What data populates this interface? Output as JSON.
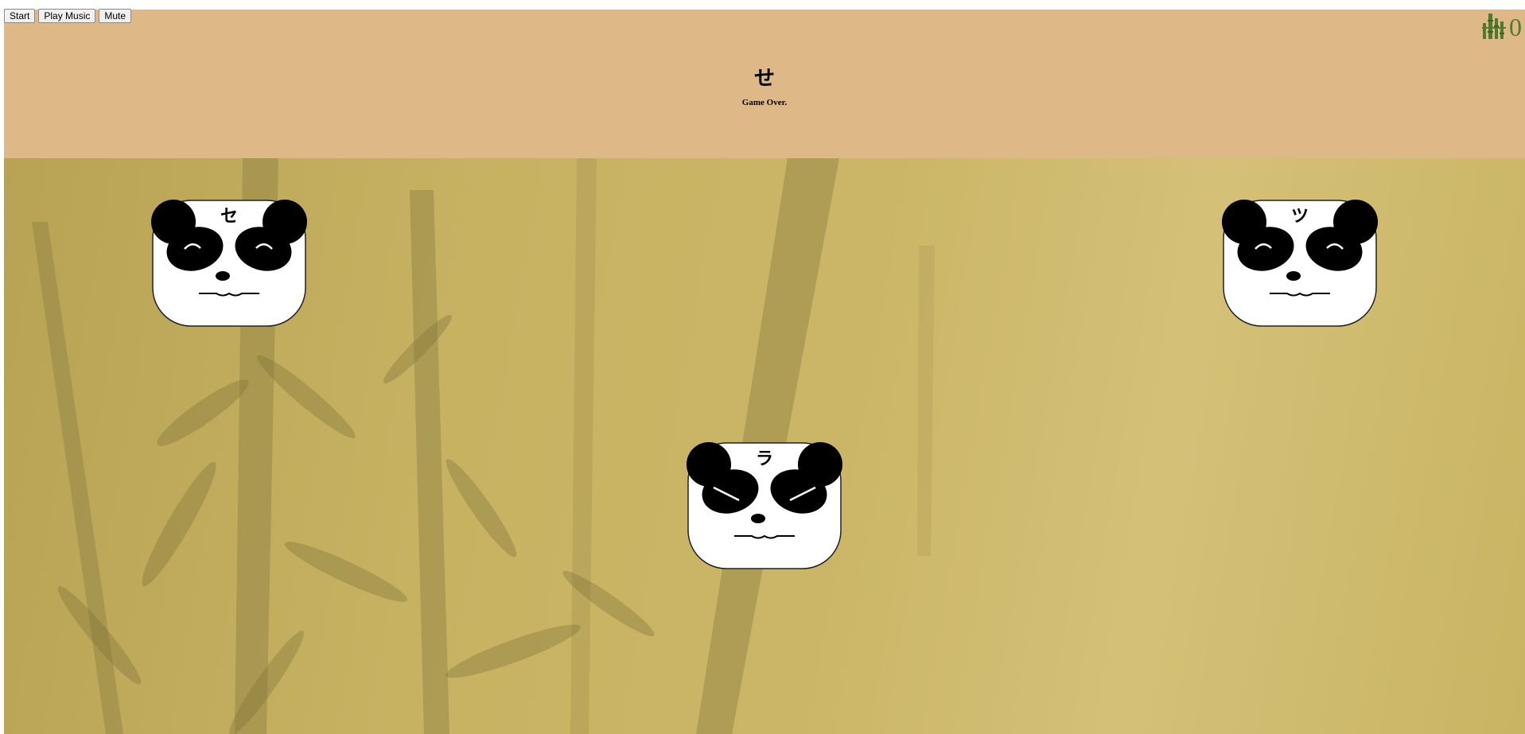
{
  "controls": {
    "start_label": "Start",
    "play_music_label": "Play Music",
    "mute_label": "Mute"
  },
  "header": {
    "target_kana": "せ",
    "status": "Game Over.",
    "score": "0",
    "score_icon": "bamboo-icon"
  },
  "pandas": [
    {
      "kana": "セ",
      "expression": "happy"
    },
    {
      "kana": "ツ",
      "expression": "happy"
    },
    {
      "kana": "ラ",
      "expression": "angry"
    }
  ],
  "colors": {
    "header_bg": "#deb887",
    "score_green": "#4f7a30"
  }
}
